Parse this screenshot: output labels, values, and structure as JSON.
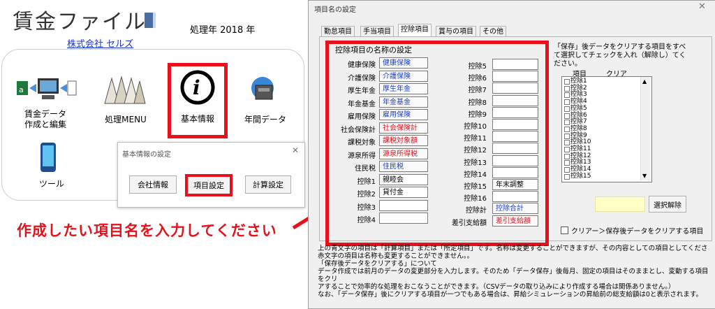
{
  "app": {
    "title": "賃金ファイル",
    "year_label": "処理年 2018 年",
    "company": "株式会社 セルズ"
  },
  "menu": {
    "tiles": [
      {
        "label1": "賃金データ",
        "label2": "作成と編集",
        "icon": "pc-transfer-icon"
      },
      {
        "label1": "処理MENU",
        "label2": "",
        "icon": "books-icon"
      },
      {
        "label1": "基本情報",
        "label2": "",
        "icon": "info-icon"
      },
      {
        "label1": "年間データ",
        "label2": "",
        "icon": "cabinet-icon"
      },
      {
        "label1": "ツール",
        "label2": "",
        "icon": "phone-icon"
      }
    ]
  },
  "kihon_dialog": {
    "title": "基本情報の設定",
    "buttons": [
      "会社情報",
      "項目設定",
      "計算設定"
    ]
  },
  "annotation": "作成したい項目名を入力してください",
  "main_dialog": {
    "title": "項目名の設定",
    "tabs": [
      "勤怠項目",
      "手当項目",
      "控除項目",
      "賞与の項目",
      "その他"
    ],
    "active_tab": "控除項目",
    "group_title": "控除項目の名称の設定",
    "left_rows": [
      {
        "label": "健康保険",
        "value": "健康保険",
        "style": "blue"
      },
      {
        "label": "介護保険",
        "value": "介護保険",
        "style": "blue"
      },
      {
        "label": "厚生年金",
        "value": "厚生年金",
        "style": "blue"
      },
      {
        "label": "年金基金",
        "value": "年金基金",
        "style": "blue"
      },
      {
        "label": "雇用保険",
        "value": "雇用保険",
        "style": "blue"
      },
      {
        "label": "社会保険計",
        "value": "社会保険計",
        "style": "red"
      },
      {
        "label": "課税対象",
        "value": "課税対象額",
        "style": "red"
      },
      {
        "label": "源泉所得",
        "value": "源泉所得税",
        "style": "red"
      },
      {
        "label": "住民税",
        "value": "住民税",
        "style": "blue"
      },
      {
        "label": "控除1",
        "value": "親睦会",
        "style": "plain"
      },
      {
        "label": "控除2",
        "value": "貸付金",
        "style": "plain"
      },
      {
        "label": "控除3",
        "value": "",
        "style": "plain"
      },
      {
        "label": "控除4",
        "value": "",
        "style": "plain"
      }
    ],
    "right_rows": [
      {
        "label": "控除5",
        "value": "",
        "style": "plain"
      },
      {
        "label": "控除6",
        "value": "",
        "style": "plain"
      },
      {
        "label": "控除7",
        "value": "",
        "style": "plain"
      },
      {
        "label": "控除8",
        "value": "",
        "style": "plain"
      },
      {
        "label": "控除9",
        "value": "",
        "style": "plain"
      },
      {
        "label": "控除10",
        "value": "",
        "style": "plain"
      },
      {
        "label": "控除11",
        "value": "",
        "style": "plain"
      },
      {
        "label": "控除12",
        "value": "",
        "style": "plain"
      },
      {
        "label": "控除13",
        "value": "",
        "style": "plain"
      },
      {
        "label": "控除14",
        "value": "",
        "style": "plain"
      },
      {
        "label": "控除15",
        "value": "年末調整",
        "style": "plain"
      },
      {
        "label": "控除16",
        "value": "",
        "style": "plain"
      },
      {
        "label": "控除計",
        "value": "控除合計",
        "style": "blue"
      },
      {
        "label": "差引支給額",
        "value": "差引支給額",
        "style": "red"
      }
    ],
    "clear_description": "「保存」後データをクリアする項目をすべて選択してチェックを入れ（解除し）てください。",
    "list_header_item": "項目",
    "list_header_clear": "クリア",
    "list_items": [
      "控除1",
      "控除2",
      "控除3",
      "控除4",
      "控除5",
      "控除6",
      "控除7",
      "控除8",
      "控除9",
      "控除10",
      "控除11",
      "控除12",
      "控除13",
      "控除14",
      "控除15"
    ],
    "clear_button": "選択解除",
    "clear_checkbox": "クリアー＞保存後データをクリアする項目",
    "notes": [
      "上の青文字の項目は「計算項目」または「所定項目」です。名称は変更することができますが、その内容としての項目としてくださ",
      "赤文字の項目は名称も変更することができません。。",
      "「保存後データをクリアする」について",
      "データ作成では前月のデータの変更部分を入力します。そのため「データ保存」後毎月、固定の項目はそのままとし、変動する項目をクリ",
      "アすることで効率的な処理をおこなうことができます。（CSVデータの取り込みにより作成する場合は関係ありません。）",
      "なお、「データ保存」後にクリアする項目が一つでもある場合は、昇給シミュレーションの昇給前の総支給額は0と表示されます。"
    ]
  }
}
